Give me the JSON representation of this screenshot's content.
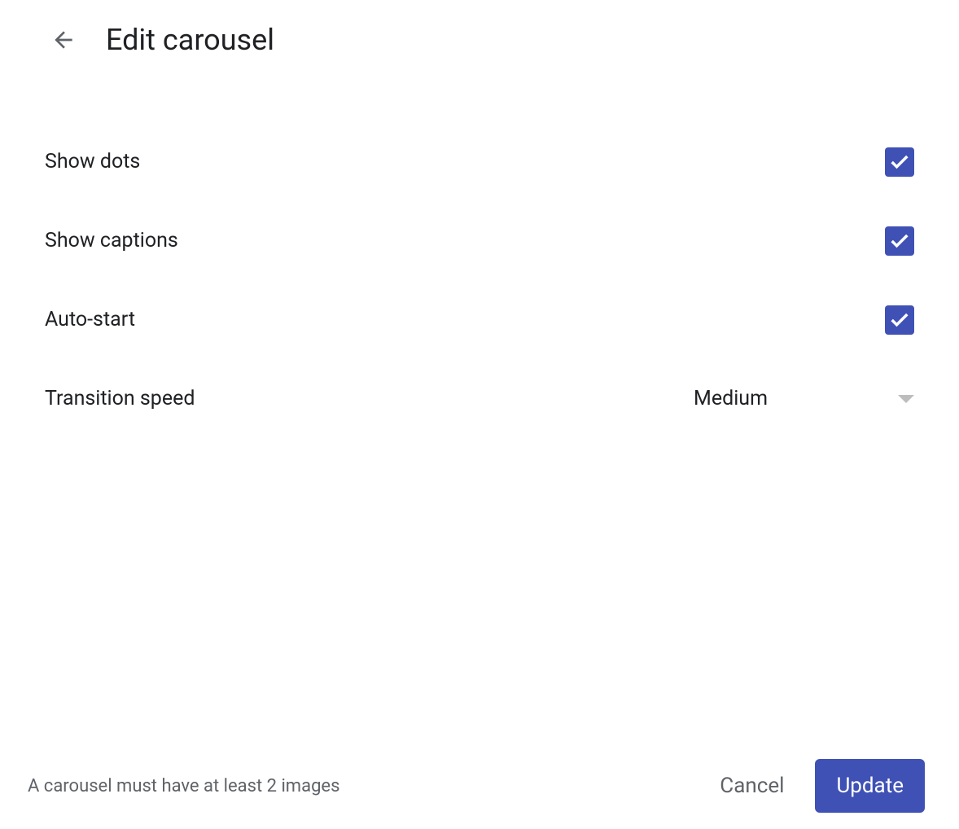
{
  "header": {
    "title": "Edit carousel"
  },
  "settings": {
    "show_dots": {
      "label": "Show dots",
      "checked": true
    },
    "show_captions": {
      "label": "Show captions",
      "checked": true
    },
    "auto_start": {
      "label": "Auto-start",
      "checked": true
    },
    "transition_speed": {
      "label": "Transition speed",
      "value": "Medium"
    }
  },
  "footer": {
    "hint": "A carousel must have at least 2 images",
    "cancel_label": "Cancel",
    "update_label": "Update"
  },
  "colors": {
    "accent": "#3f51b5",
    "text_primary": "#202124",
    "text_secondary": "#5f6368"
  }
}
